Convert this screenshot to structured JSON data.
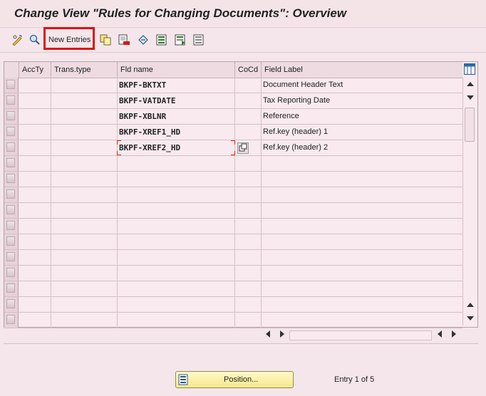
{
  "window": {
    "title": "Change View \"Rules for Changing Documents\": Overview"
  },
  "toolbar": {
    "new_entries_label": "New Entries",
    "icons": [
      "display-change-icon",
      "find-icon",
      "copy-icon",
      "delete-icon",
      "undo-icon",
      "select-all-icon",
      "select-block-icon",
      "deselect-all-icon"
    ]
  },
  "table": {
    "columns": [
      "AccTy",
      "Trans.type",
      "Fld name",
      "CoCd",
      "Field Label"
    ],
    "rows": [
      {
        "accty": "",
        "trans_type": "",
        "fld_name": "BKPF-BKTXT",
        "cocd": "",
        "field_label": "Document Header Text"
      },
      {
        "accty": "",
        "trans_type": "",
        "fld_name": "BKPF-VATDATE",
        "cocd": "",
        "field_label": "Tax Reporting Date"
      },
      {
        "accty": "",
        "trans_type": "",
        "fld_name": "BKPF-XBLNR",
        "cocd": "",
        "field_label": "Reference"
      },
      {
        "accty": "",
        "trans_type": "",
        "fld_name": "BKPF-XREF1_HD",
        "cocd": "",
        "field_label": "Ref.key (header) 1"
      },
      {
        "accty": "",
        "trans_type": "",
        "fld_name": "BKPF-XREF2_HD",
        "cocd": "",
        "field_label": "Ref.key (header) 2"
      }
    ],
    "empty_rows": 11
  },
  "footer": {
    "position_label": "Position...",
    "entry_status": "Entry 1 of 5"
  },
  "colors": {
    "highlight_border": "#e01010",
    "background": "#f4e6ea"
  }
}
